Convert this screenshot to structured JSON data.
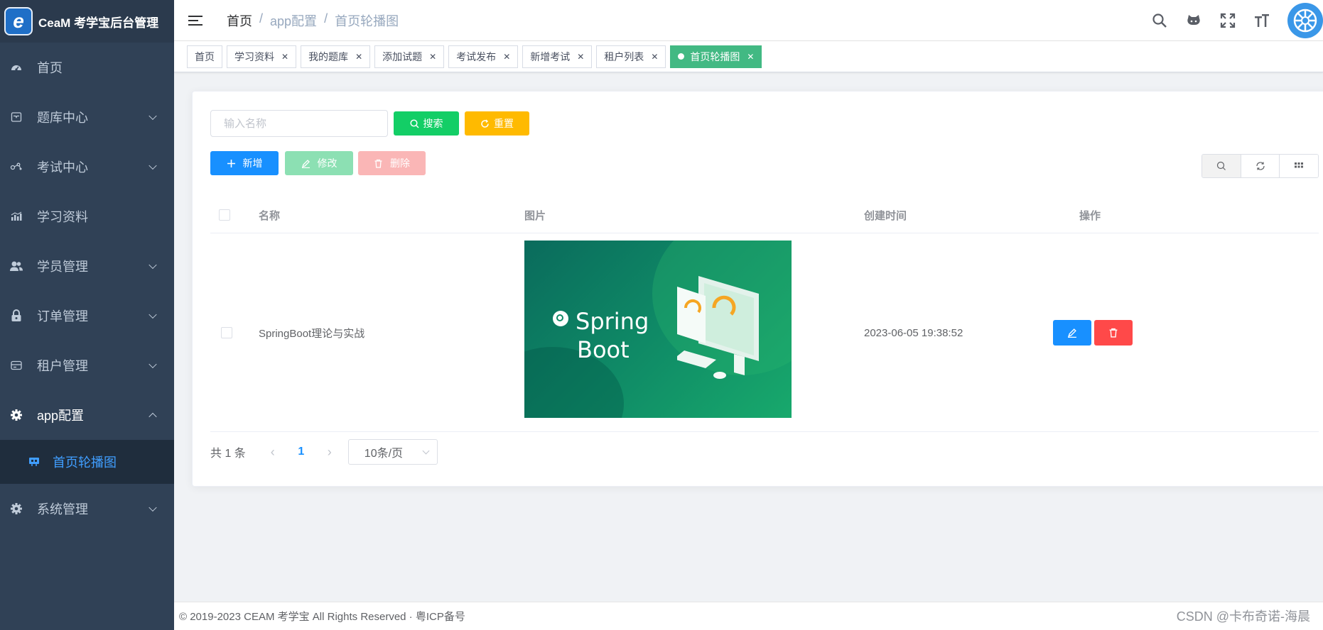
{
  "app": {
    "logo_letter": "e",
    "title": "CeaM 考学宝后台管理"
  },
  "sidebar": {
    "items": [
      {
        "label": "首页",
        "icon": "dashboard-icon",
        "expandable": false
      },
      {
        "label": "题库中心",
        "icon": "inbox-icon",
        "expandable": true
      },
      {
        "label": "考试中心",
        "icon": "nodes-icon",
        "expandable": true
      },
      {
        "label": "学习资料",
        "icon": "chart-icon",
        "expandable": false
      },
      {
        "label": "学员管理",
        "icon": "users-icon",
        "expandable": true
      },
      {
        "label": "订单管理",
        "icon": "lock-icon",
        "expandable": true
      },
      {
        "label": "租户管理",
        "icon": "card-icon",
        "expandable": true
      },
      {
        "label": "app配置",
        "icon": "gear-icon",
        "expandable": true,
        "open": true
      },
      {
        "label": "系统管理",
        "icon": "gear-icon",
        "expandable": true
      }
    ],
    "subitem": {
      "label": "首页轮播图",
      "icon": "carousel-icon"
    }
  },
  "header": {
    "breadcrumb": [
      "首页",
      "app配置",
      "首页轮播图"
    ],
    "separator": "/"
  },
  "tags": [
    {
      "label": "首页",
      "closable": false
    },
    {
      "label": "学习资料",
      "closable": true
    },
    {
      "label": "我的题库",
      "closable": true
    },
    {
      "label": "添加试题",
      "closable": true
    },
    {
      "label": "考试发布",
      "closable": true
    },
    {
      "label": "新增考试",
      "closable": true
    },
    {
      "label": "租户列表",
      "closable": true
    },
    {
      "label": "首页轮播图",
      "closable": true,
      "active": true
    }
  ],
  "toolbar": {
    "search_placeholder": "输入名称",
    "search_label": "搜索",
    "reset_label": "重置",
    "add_label": "新增",
    "edit_label": "修改",
    "delete_label": "删除"
  },
  "table": {
    "columns": [
      "名称",
      "图片",
      "创建时间",
      "操作"
    ],
    "rows": [
      {
        "name": "SpringBoot理论与实战",
        "image_text_1": "Spring",
        "image_text_2": "Boot",
        "created": "2023-06-05 19:38:52"
      }
    ]
  },
  "pagination": {
    "total": "共 1 条",
    "page": "1",
    "page_size": "10条/页"
  },
  "footer": {
    "text": "© 2019-2023 CEAM 考学宝 All Rights Reserved · 粤ICP备号"
  },
  "watermark": "CSDN @卡布奇诺-海晨",
  "colors": {
    "sidebar_bg": "#304156",
    "primary": "#1890ff",
    "success": "#13ce66",
    "warning": "#ffba00",
    "danger": "#ff4949",
    "tag_active": "#42b983"
  }
}
